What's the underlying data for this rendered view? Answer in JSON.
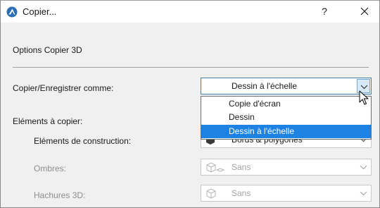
{
  "window": {
    "title": "Copier...",
    "help_label": "?",
    "close_label": "×"
  },
  "section": {
    "title": "Options Copier 3D"
  },
  "copy_as": {
    "label": "Copier/Enregistrer comme:",
    "selected": "Dessin à l'échelle",
    "options": [
      "Copie d'écran",
      "Dessin",
      "Dessin à l'échelle"
    ],
    "highlighted_index": 2
  },
  "elements": {
    "label": "Eléments à copier:",
    "construction": {
      "label": "Eléments de construction:",
      "value": "Bords & polygones"
    },
    "shadows": {
      "label": "Ombres:",
      "value": "Sans"
    },
    "hatches": {
      "label": "Hachures 3D:",
      "value": "Sans"
    }
  },
  "colors": {
    "accent": "#1e82e3",
    "app_icon": "#2a6fb6",
    "disabled_text": "#8d8d8d"
  },
  "icons": {
    "app": "archicad-icon",
    "close": "close-icon",
    "arrow": "chevron-down-icon",
    "cursor": "mouse-pointer-icon"
  }
}
